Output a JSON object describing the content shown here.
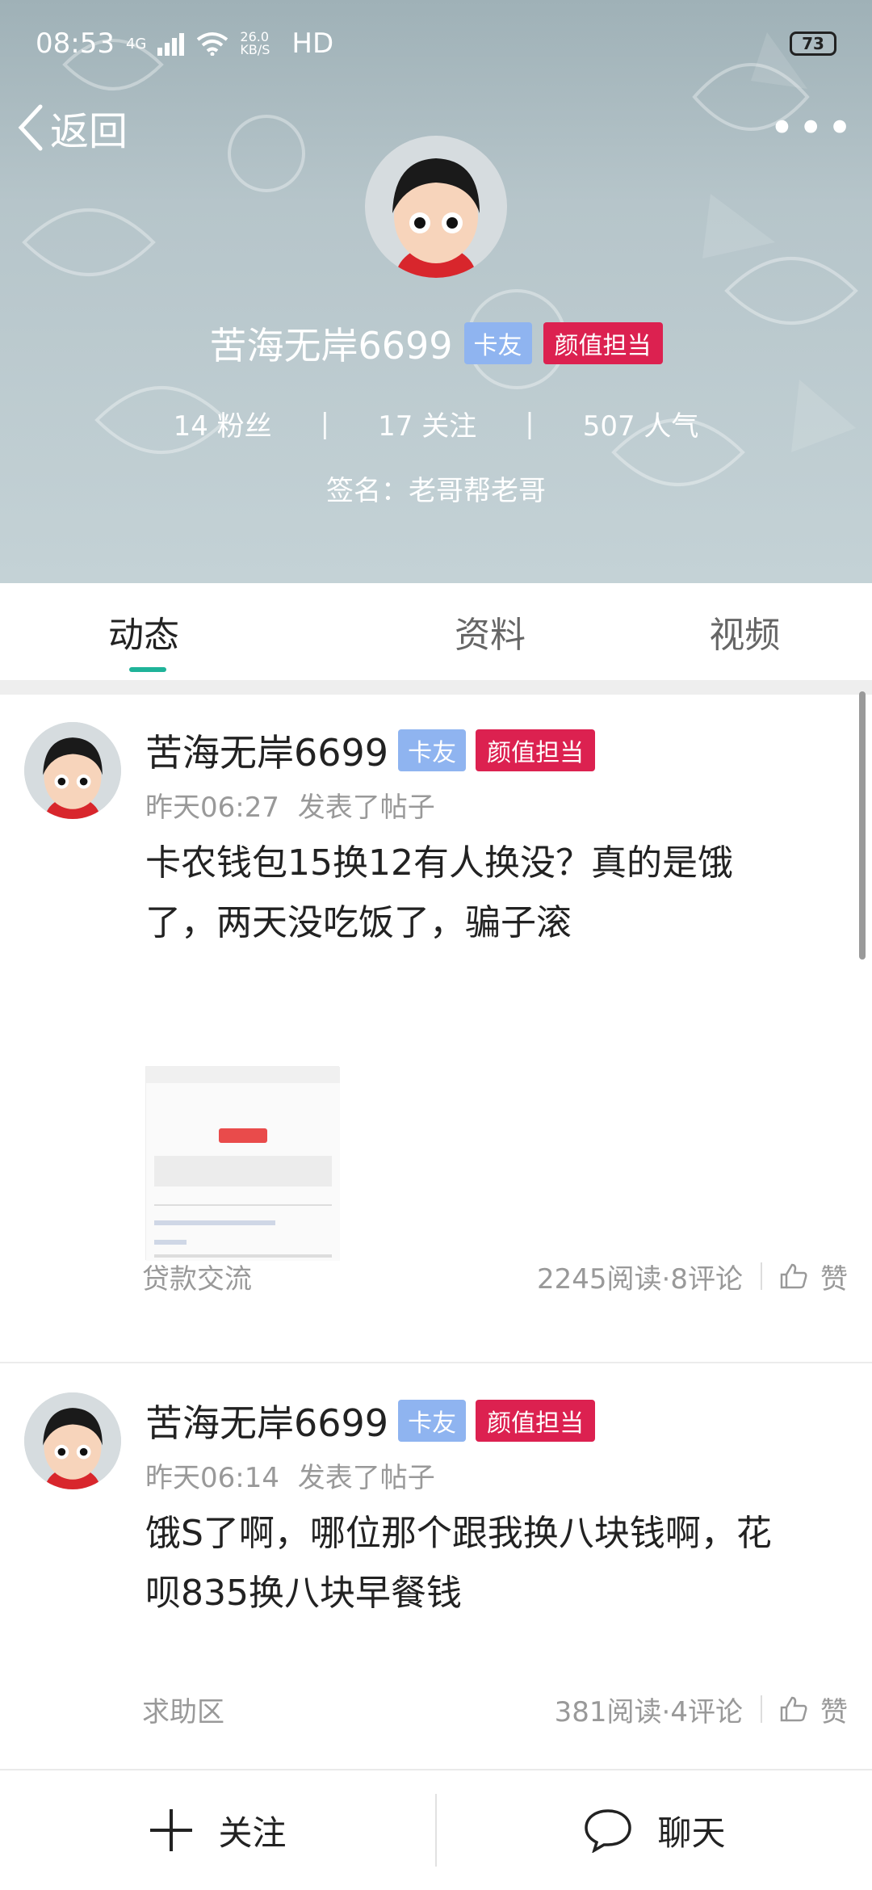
{
  "status_bar": {
    "time": "08:53",
    "network": "4G",
    "speed": "26.0 KB/S",
    "hd": "HD",
    "battery": "73"
  },
  "topbar": {
    "back_label": "返回"
  },
  "profile": {
    "name": "苦海无岸6699",
    "badge_blue": "卡友",
    "badge_red": "颜值担当",
    "fans": "14 粉丝",
    "follows": "17 关注",
    "popularity": "507 人气",
    "signature": "签名：老哥帮老哥"
  },
  "tabs": [
    {
      "label": "动态",
      "active": true
    },
    {
      "label": "资料",
      "active": false
    },
    {
      "label": "视频",
      "active": false
    }
  ],
  "posts": [
    {
      "name": "苦海无岸6699",
      "badge_blue": "卡友",
      "badge_red": "颜值担当",
      "time": "昨天06:27",
      "action": "发表了帖子",
      "content_line1": "卡农钱包15换12有人换没？真的是饿",
      "content_line2": "了，两天没吃饭了，骗子滚",
      "category": "贷款交流",
      "stats": "2245阅读·8评论",
      "like_label": "赞"
    },
    {
      "name": "苦海无岸6699",
      "badge_blue": "卡友",
      "badge_red": "颜值担当",
      "time": "昨天06:14",
      "action": "发表了帖子",
      "content_line1": "饿S了啊，哪位那个跟我换八块钱啊，花",
      "content_line2": "呗835换八块早餐钱",
      "category": "求助区",
      "stats": "381阅读·4评论",
      "like_label": "赞"
    }
  ],
  "bottom_bar": {
    "follow_label": "关注",
    "chat_label": "聊天"
  },
  "colors": {
    "accent_green": "#1fb399",
    "badge_blue": "#8fb4f0",
    "badge_red": "#dc2150"
  }
}
